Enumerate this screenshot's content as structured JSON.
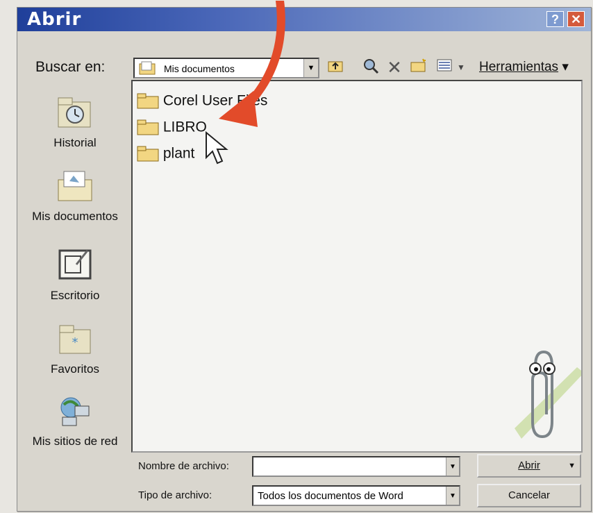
{
  "dialog": {
    "title": "Abrir",
    "help_label": "?",
    "close_label": "✕"
  },
  "toolbar": {
    "look_in_label": "Buscar en:",
    "look_in_value": "Mis documentos",
    "tools_label": "Herramientas"
  },
  "places": [
    {
      "label": "Historial",
      "icon": "history-icon"
    },
    {
      "label": "Mis documentos",
      "icon": "my-documents-icon"
    },
    {
      "label": "Escritorio",
      "icon": "desktop-icon"
    },
    {
      "label": "Favoritos",
      "icon": "favorites-icon"
    },
    {
      "label": "Mis sitios de red",
      "icon": "network-places-icon"
    }
  ],
  "files": [
    {
      "name": "Corel User Files",
      "icon": "folder-icon"
    },
    {
      "name": "LIBRO",
      "icon": "folder-icon"
    },
    {
      "name": "plant",
      "icon": "folder-icon"
    }
  ],
  "fields": {
    "filename_label": "Nombre de archivo:",
    "filename_value": "",
    "filetype_label": "Tipo de archivo:",
    "filetype_value": "Todos los documentos de Word"
  },
  "buttons": {
    "open_label": "Abrir",
    "cancel_label": "Cancelar"
  },
  "colors": {
    "title_bar": "#1f3f9a",
    "annotation_arrow": "#e24b2a"
  }
}
